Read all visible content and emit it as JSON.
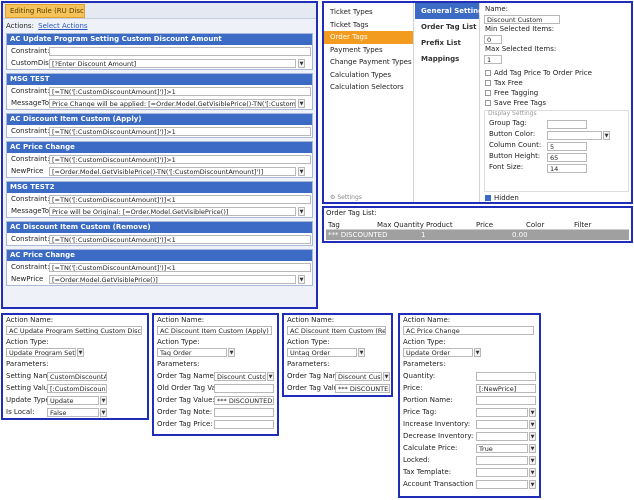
{
  "editor": {
    "tab_title": "Editing Rule (RU Disco",
    "actions_label": "Actions:",
    "select_actions": "Select Actions",
    "blocks": [
      {
        "title": "AC Update Program Setting Custom Discount Amount",
        "rows": [
          {
            "label": "Constraint:",
            "value": "",
            "dropdown": false
          },
          {
            "label": "CustomDiscountAmount",
            "value": "[?Enter Discount Amount]",
            "dropdown": true
          }
        ]
      },
      {
        "title": "MSG TEST",
        "rows": [
          {
            "label": "Constraint:",
            "value": "[=TN('[:CustomDiscountAmount]')]>1",
            "dropdown": false
          },
          {
            "label": "MessageToDisplay",
            "value": "Price Change will be applied: [=Order.Model.GetVisiblePrice()-TN('[:CustomDiscountAmount]')]",
            "dropdown": true
          }
        ]
      },
      {
        "title": "AC Discount Item Custom (Apply)",
        "rows": [
          {
            "label": "Constraint:",
            "value": "[=TN('[:CustomDiscountAmount]')]>1",
            "dropdown": false
          }
        ]
      },
      {
        "title": "AC Price Change",
        "rows": [
          {
            "label": "Constraint:",
            "value": "[=TN('[:CustomDiscountAmount]')]>1",
            "dropdown": false
          },
          {
            "label": "NewPrice",
            "value": "[=Order.Model.GetVisiblePrice()-TN('[:CustomDiscountAmount]')]",
            "dropdown": true
          }
        ]
      },
      {
        "title": "MSG TEST2",
        "rows": [
          {
            "label": "Constraint:",
            "value": "[=TN('[:CustomDiscountAmount]')]<1",
            "dropdown": false
          },
          {
            "label": "MessageToDisplay",
            "value": "Price will be Original: [=Order.Model.GetVisiblePrice()]",
            "dropdown": true
          }
        ]
      },
      {
        "title": "AC Discount Item Custom (Remove)",
        "rows": [
          {
            "label": "Constraint:",
            "value": "[=TN('[:CustomDiscountAmount]')]<1",
            "dropdown": false
          }
        ]
      },
      {
        "title": "AC Price Change",
        "rows": [
          {
            "label": "Constraint:",
            "value": "[=TN('[:CustomDiscountAmount]')]<1",
            "dropdown": false
          },
          {
            "label": "NewPrice",
            "value": "[=Order.Model.GetVisiblePrice()]",
            "dropdown": true
          }
        ]
      }
    ]
  },
  "settings": {
    "nav": [
      "Ticket Types",
      "Ticket Tags",
      "Order Tags",
      "Payment Types",
      "Change Payment Types",
      "Calculation Types",
      "Calculation Selectors"
    ],
    "nav_active": 2,
    "nav_footer": "Settings",
    "subnav": [
      "General Settings",
      "Order Tag List",
      "Prefix List",
      "Mappings"
    ],
    "subnav_active": 0,
    "name_label": "Name:",
    "name_value": "Discount Custom",
    "min_label": "Min Selected Items:",
    "min_value": "0",
    "max_label": "Max Selected Items:",
    "max_value": "1",
    "checkboxes": [
      {
        "label": "Add Tag Price To Order Price",
        "checked": false
      },
      {
        "label": "Tax Free",
        "checked": false
      },
      {
        "label": "Free Tagging",
        "checked": false
      },
      {
        "label": "Save Free Tags",
        "checked": false
      }
    ],
    "display_title": "Display Settings",
    "display_fields": [
      {
        "label": "Group Tag:",
        "value": ""
      },
      {
        "label": "Button Color:",
        "value": ""
      },
      {
        "label": "Column Count:",
        "value": "5"
      },
      {
        "label": "Button Height:",
        "value": "65"
      },
      {
        "label": "Font Size:",
        "value": "14"
      }
    ],
    "hidden_label": "Hidden",
    "hidden_checked": true
  },
  "tag_list": {
    "title": "Order Tag List:",
    "columns": [
      "Tag",
      "Max Quantity",
      "Product",
      "Price",
      "Color",
      "Filter"
    ],
    "rows": [
      {
        "tag": "*** DISCOUNTED",
        "max_quantity": "1",
        "product": "",
        "price": "0.00",
        "color": "",
        "filter": ""
      }
    ]
  },
  "action_update": {
    "name_label": "Action Name:",
    "name_value": "AC Update Program Setting Custom Discount Amount",
    "type_label": "Action Type:",
    "type_value": "Update Program Setting",
    "params_label": "Parameters:",
    "params": [
      {
        "label": "Setting Name:",
        "value": "CustomDiscountAmount",
        "dropdown": false
      },
      {
        "label": "Setting Value:",
        "value": "[:CustomDiscountAmount]",
        "dropdown": false
      },
      {
        "label": "Update Type:",
        "value": "Update",
        "dropdown": true
      },
      {
        "label": "Is Local:",
        "value": "False",
        "dropdown": true
      }
    ]
  },
  "action_apply": {
    "name_label": "Action Name:",
    "name_value": "AC Discount Item Custom (Apply)",
    "type_label": "Action Type:",
    "type_value": "Tag Order",
    "params_label": "Parameters:",
    "params": [
      {
        "label": "Order Tag Name:",
        "value": "Discount Custom",
        "dropdown": true
      },
      {
        "label": "Old Order Tag Value:",
        "value": "",
        "dropdown": false
      },
      {
        "label": "Order Tag Value:",
        "value": "*** DISCOUNTED",
        "dropdown": false
      },
      {
        "label": "Order Tag Note:",
        "value": "",
        "dropdown": false
      },
      {
        "label": "Order Tag Price:",
        "value": "",
        "dropdown": false
      }
    ]
  },
  "action_remove": {
    "name_label": "Action Name:",
    "name_value": "AC Discount Item Custom (Remove)",
    "type_label": "Action Type:",
    "type_value": "Untag Order",
    "params_label": "Parameters:",
    "params": [
      {
        "label": "Order Tag Name:",
        "value": "Discount Custom",
        "dropdown": true
      },
      {
        "label": "Order Tag Value:",
        "value": "*** DISCOUNTED",
        "dropdown": false
      }
    ]
  },
  "action_price": {
    "name_label": "Action Name:",
    "name_value": "AC Price Change",
    "type_label": "Action Type:",
    "type_value": "Update Order",
    "params_label": "Parameters:",
    "params": [
      {
        "label": "Quantity:",
        "value": "",
        "dropdown": false
      },
      {
        "label": "Price:",
        "value": "[:NewPrice]",
        "dropdown": false
      },
      {
        "label": "Portion Name:",
        "value": "",
        "dropdown": false
      },
      {
        "label": "Price Tag:",
        "value": "",
        "dropdown": true
      },
      {
        "label": "Increase Inventory:",
        "value": "",
        "dropdown": true
      },
      {
        "label": "Decrease Inventory:",
        "value": "",
        "dropdown": true
      },
      {
        "label": "Calculate Price:",
        "value": "True",
        "dropdown": true
      },
      {
        "label": "Locked:",
        "value": "",
        "dropdown": true
      },
      {
        "label": "Tax Template:",
        "value": "",
        "dropdown": true
      },
      {
        "label": "Account Transaction Type:",
        "value": "",
        "dropdown": true
      }
    ]
  }
}
